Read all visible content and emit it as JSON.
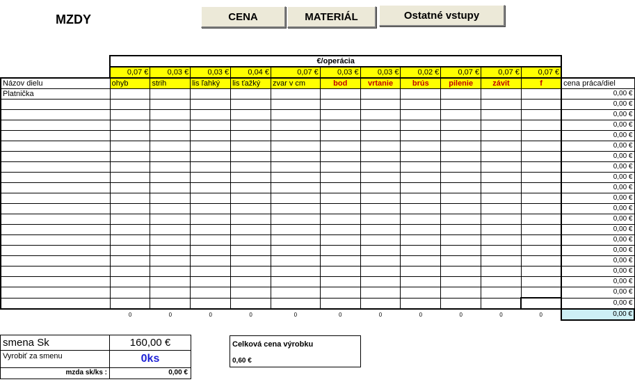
{
  "page_title": "MZDY",
  "buttons": {
    "cena": "CENA",
    "material": "MATERIÁL",
    "ostatne": "Ostatné vstupy"
  },
  "header_band": "€/operácia",
  "columns": {
    "name": "Názov dielu",
    "result": "cena práca/diel",
    "ops": [
      {
        "label": "ohyb",
        "price": "0,07 €",
        "style": "normal"
      },
      {
        "label": "strih",
        "price": "0,03 €",
        "style": "normal"
      },
      {
        "label": "lis ľahký",
        "price": "0,03 €",
        "style": "normal"
      },
      {
        "label": "lis ťažký",
        "price": "0,04 €",
        "style": "normal"
      },
      {
        "label": "zvar v cm",
        "price": "0,07 €",
        "style": "normal"
      },
      {
        "label": "bod",
        "price": "0,03 €",
        "style": "red"
      },
      {
        "label": "vrtanie",
        "price": "0,03 €",
        "style": "red"
      },
      {
        "label": "brús",
        "price": "0,02 €",
        "style": "red"
      },
      {
        "label": "pilenie",
        "price": "0,07 €",
        "style": "red"
      },
      {
        "label": "závit",
        "price": "0,07 €",
        "style": "red"
      },
      {
        "label": "f",
        "price": "0,07 €",
        "style": "red"
      }
    ]
  },
  "rows": [
    {
      "name": "Platnička",
      "value": "0,00 €"
    },
    {
      "name": "",
      "value": "0,00 €"
    },
    {
      "name": "",
      "value": "0,00 €"
    },
    {
      "name": "",
      "value": "0,00 €"
    },
    {
      "name": "",
      "value": "0,00 €"
    },
    {
      "name": "",
      "value": "0,00 €"
    },
    {
      "name": "",
      "value": "0,00 €"
    },
    {
      "name": "",
      "value": "0,00 €"
    },
    {
      "name": "",
      "value": "0,00 €"
    },
    {
      "name": "",
      "value": "0,00 €"
    },
    {
      "name": "",
      "value": "0,00 €"
    },
    {
      "name": "",
      "value": "0,00 €"
    },
    {
      "name": "",
      "value": "0,00 €"
    },
    {
      "name": "",
      "value": "0,00 €"
    },
    {
      "name": "",
      "value": "0,00 €"
    },
    {
      "name": "",
      "value": "0,00 €"
    },
    {
      "name": "",
      "value": "0,00 €"
    },
    {
      "name": "",
      "value": "0,00 €"
    },
    {
      "name": "",
      "value": "0,00 €"
    },
    {
      "name": "",
      "value": "0,00 €"
    },
    {
      "name": "",
      "value": "0,00 €"
    }
  ],
  "totals": {
    "counts": [
      "0",
      "0",
      "0",
      "0",
      "0",
      "0",
      "0",
      "0",
      "0",
      "0",
      "0"
    ],
    "grand": "0,00 €"
  },
  "summary": {
    "shift_label": "smena Sk",
    "shift_value": "160,00 €",
    "produce_label": "Vyrobiť za smenu",
    "produce_value": "0ks",
    "wage_label": "mzda sk/ks :",
    "wage_value": "0,00 €"
  },
  "product": {
    "label": "Celková cena výrobku",
    "value": "0,60 €"
  },
  "colors": {
    "header_yellow": "#ffff00",
    "red_label": "#c00000",
    "produce_blue": "#1e22d6",
    "total_cyan": "#cdeff5",
    "button_face": "#ece9d8"
  }
}
